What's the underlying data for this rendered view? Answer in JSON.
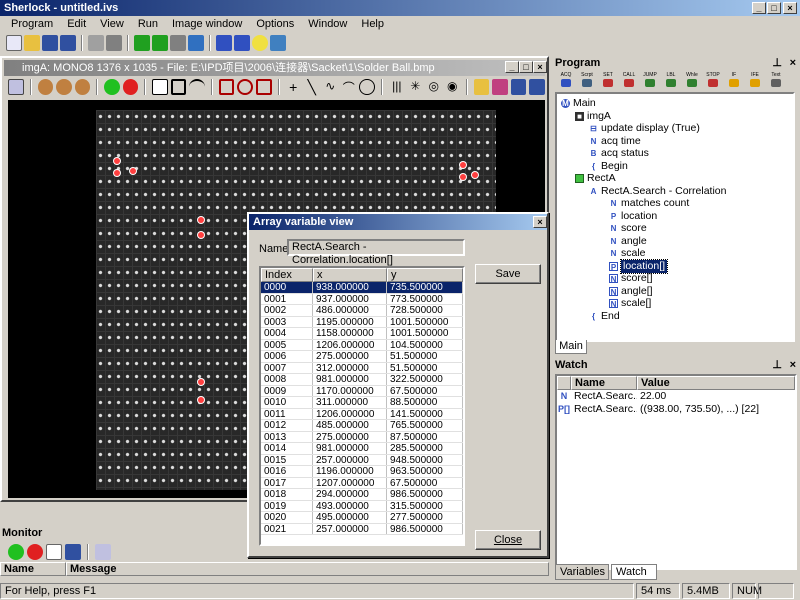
{
  "app": {
    "title": "Sherlock - untitled.ivs"
  },
  "menubar": [
    "Program",
    "Edit",
    "View",
    "Run",
    "Image window",
    "Options",
    "Window",
    "Help"
  ],
  "image_window": {
    "title": "imgA: MONO8 1376 x 1035 - File: E:\\IPD项目\\2006\\连接器\\Sacket\\1\\Solder Ball.bmp"
  },
  "dialog": {
    "title": "Array variable view",
    "name_label": "Name",
    "name_value": "RectA.Search - Correlation.location[]",
    "save_label": "Save",
    "close_label": "Close",
    "columns": [
      "Index",
      "x",
      "y"
    ],
    "rows": [
      [
        "0000",
        "938.000000",
        "735.500000"
      ],
      [
        "0001",
        "937.000000",
        "773.500000"
      ],
      [
        "0002",
        "486.000000",
        "728.500000"
      ],
      [
        "0003",
        "1195.000000",
        "1001.500000"
      ],
      [
        "0004",
        "1158.000000",
        "1001.500000"
      ],
      [
        "0005",
        "1206.000000",
        "104.500000"
      ],
      [
        "0006",
        "275.000000",
        "51.500000"
      ],
      [
        "0007",
        "312.000000",
        "51.500000"
      ],
      [
        "0008",
        "981.000000",
        "322.500000"
      ],
      [
        "0009",
        "1170.000000",
        "67.500000"
      ],
      [
        "0010",
        "311.000000",
        "88.500000"
      ],
      [
        "0011",
        "1206.000000",
        "141.500000"
      ],
      [
        "0012",
        "485.000000",
        "765.500000"
      ],
      [
        "0013",
        "275.000000",
        "87.500000"
      ],
      [
        "0014",
        "981.000000",
        "285.500000"
      ],
      [
        "0015",
        "257.000000",
        "948.500000"
      ],
      [
        "0016",
        "1196.000000",
        "963.500000"
      ],
      [
        "0017",
        "1207.000000",
        "67.500000"
      ],
      [
        "0018",
        "294.000000",
        "986.500000"
      ],
      [
        "0019",
        "493.000000",
        "315.500000"
      ],
      [
        "0020",
        "495.000000",
        "277.500000"
      ],
      [
        "0021",
        "257.000000",
        "986.500000"
      ]
    ]
  },
  "program": {
    "header": "Program",
    "toolbar_labels": [
      "ACQ",
      "Scrpt",
      "SET",
      "CALL",
      "JUMP",
      "LBL",
      "WhIe",
      "STOP",
      "IF",
      "IFE",
      "Text"
    ],
    "tree": [
      {
        "label": "Main",
        "icon": "main"
      },
      {
        "label": "imgA",
        "icon": "img"
      },
      {
        "label": "update display (True)",
        "icon": "op"
      },
      {
        "label": "acq time",
        "icon": "N"
      },
      {
        "label": "acq status",
        "icon": "B"
      },
      {
        "label": "Begin",
        "icon": "brace"
      },
      {
        "label": "RectA",
        "icon": "rect"
      },
      {
        "label": "RectA.Search - Correlation",
        "icon": "alg"
      },
      {
        "label": "matches count",
        "icon": "N"
      },
      {
        "label": "location",
        "icon": "P"
      },
      {
        "label": "score",
        "icon": "N"
      },
      {
        "label": "angle",
        "icon": "N"
      },
      {
        "label": "scale",
        "icon": "N"
      },
      {
        "label": "location[]",
        "icon": "P[]"
      },
      {
        "label": "score[]",
        "icon": "N[]"
      },
      {
        "label": "angle[]",
        "icon": "N[]"
      },
      {
        "label": "scale[]",
        "icon": "N[]"
      },
      {
        "label": "End",
        "icon": "brace"
      }
    ],
    "tab": "Main"
  },
  "watch": {
    "header": "Watch",
    "columns": [
      "Name",
      "Value"
    ],
    "rows": [
      {
        "icon": "N",
        "name": "RectA.Searc...",
        "value": "22.00"
      },
      {
        "icon": "P[]",
        "name": "RectA.Searc...",
        "value": "((938.00, 735.50), ...) [22]"
      }
    ],
    "tabs": [
      "Variables",
      "Watch"
    ]
  },
  "monitor": {
    "header": "Monitor",
    "columns": [
      "Name",
      "Message"
    ]
  },
  "status": {
    "help": "For Help, press F1",
    "time": "54 ms",
    "memory": "5.4MB",
    "num": "NUM"
  },
  "colors": {
    "title_active": "#0a246a",
    "selection": "#0a246a",
    "chrome": "#d4d0c8"
  }
}
